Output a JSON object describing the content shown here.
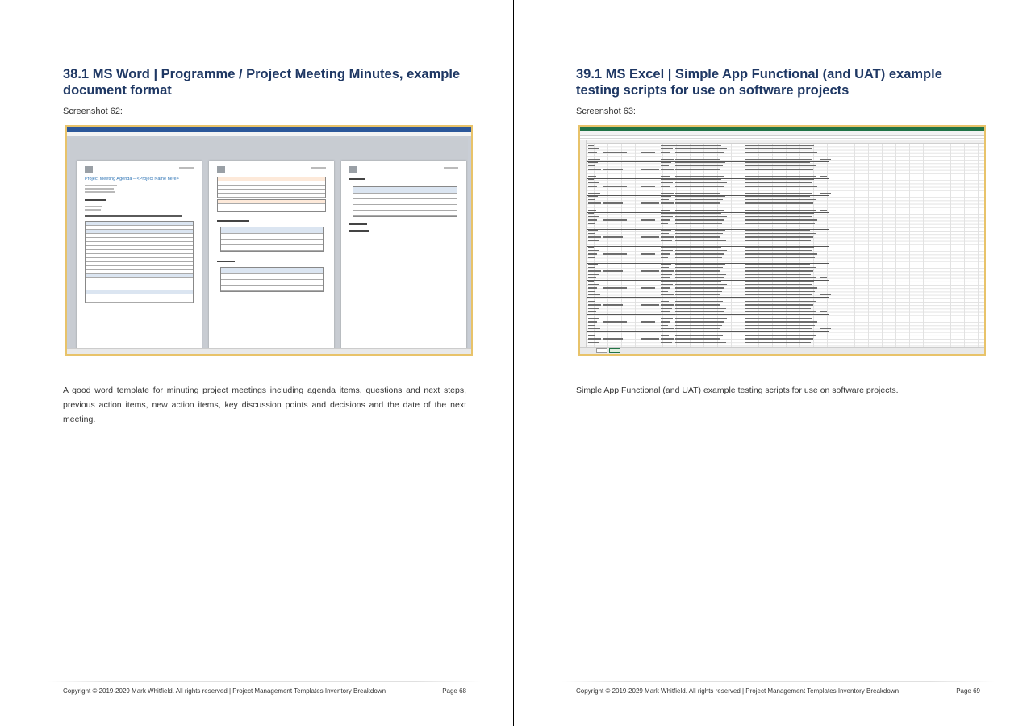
{
  "left_page": {
    "heading": "38.1  MS Word | Programme / Project Meeting Minutes, example document format",
    "screenshot_label": "Screenshot 62:",
    "description": "A good word template for minuting project meetings including agenda items, questions and next steps, previous action items, new action items, key discussion points and decisions and the date of the next meeting.",
    "footer_left": "Copyright © 2019-2029 Mark Whitfield. All rights reserved | Project Management Templates Inventory Breakdown",
    "footer_right": "Page 68",
    "word": {
      "doc_title": "Project Meeting Agenda – <Project Name here>"
    }
  },
  "right_page": {
    "heading": "39.1  MS Excel | Simple App Functional (and UAT) example testing scripts for use on software projects",
    "screenshot_label": "Screenshot 63:",
    "description": "Simple App Functional (and UAT) example testing scripts for use on software projects.",
    "footer_left": "Copyright © 2019-2029 Mark Whitfield. All rights reserved | Project Management Templates Inventory Breakdown",
    "footer_right": "Page 69"
  }
}
